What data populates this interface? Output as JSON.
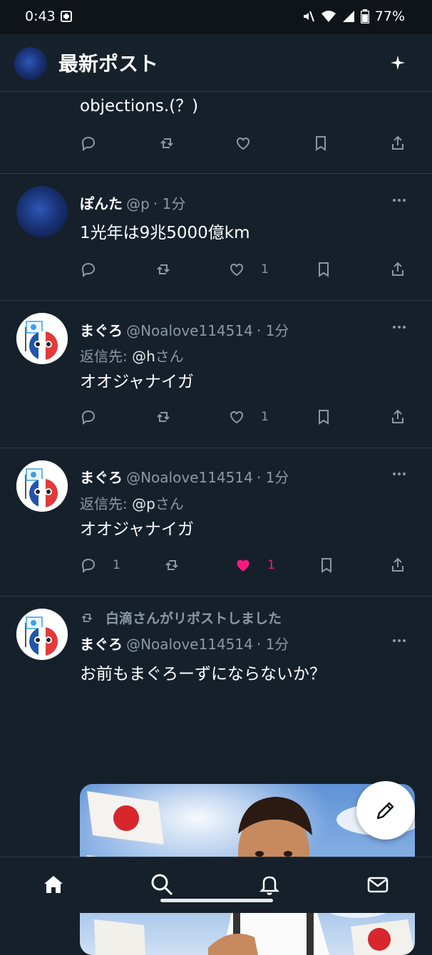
{
  "status_bar": {
    "time": "0:43",
    "battery": "77%"
  },
  "header": {
    "title": "最新ポスト"
  },
  "tweets": [
    {
      "text": "objections.(？)",
      "actions": {
        "reply_count": "",
        "repost_count": "",
        "like_count": ""
      }
    },
    {
      "name": "ぽんた",
      "handle": "@p",
      "time": "· 1分",
      "text": "1光年は9兆5000億km",
      "actions": {
        "reply_count": "",
        "repost_count": "",
        "like_count": "1"
      }
    },
    {
      "name": "まぐろ",
      "handle": "@Noalove114514",
      "time": "· 1分",
      "reply_prefix": "返信先: ",
      "reply_target": "@h",
      "reply_suffix": "さん",
      "text": "オオジャナイガ",
      "actions": {
        "reply_count": "",
        "repost_count": "",
        "like_count": "1"
      }
    },
    {
      "name": "まぐろ",
      "handle": "@Noalove114514",
      "time": "· 1分",
      "reply_prefix": "返信先: ",
      "reply_target": "@p",
      "reply_suffix": "さん",
      "text": "オオジャナイガ",
      "actions": {
        "reply_count": "1",
        "repost_count": "",
        "like_count": "1",
        "liked": true
      }
    },
    {
      "repost_context": "白滴さんがリポストしました",
      "name": "まぐろ",
      "handle": "@Noalove114514",
      "time": "· 1分",
      "text": "お前もまぐろーずにならないか？"
    }
  ],
  "colors": {
    "background": "#15202b",
    "like_active": "#f91880",
    "secondary_text": "#8b98a5"
  },
  "icons": [
    "sparkle-icon",
    "reply-icon",
    "repost-icon",
    "like-icon",
    "bookmark-icon",
    "share-icon",
    "more-icon",
    "compose-icon",
    "home-icon",
    "search-icon",
    "notifications-icon",
    "messages-icon"
  ]
}
